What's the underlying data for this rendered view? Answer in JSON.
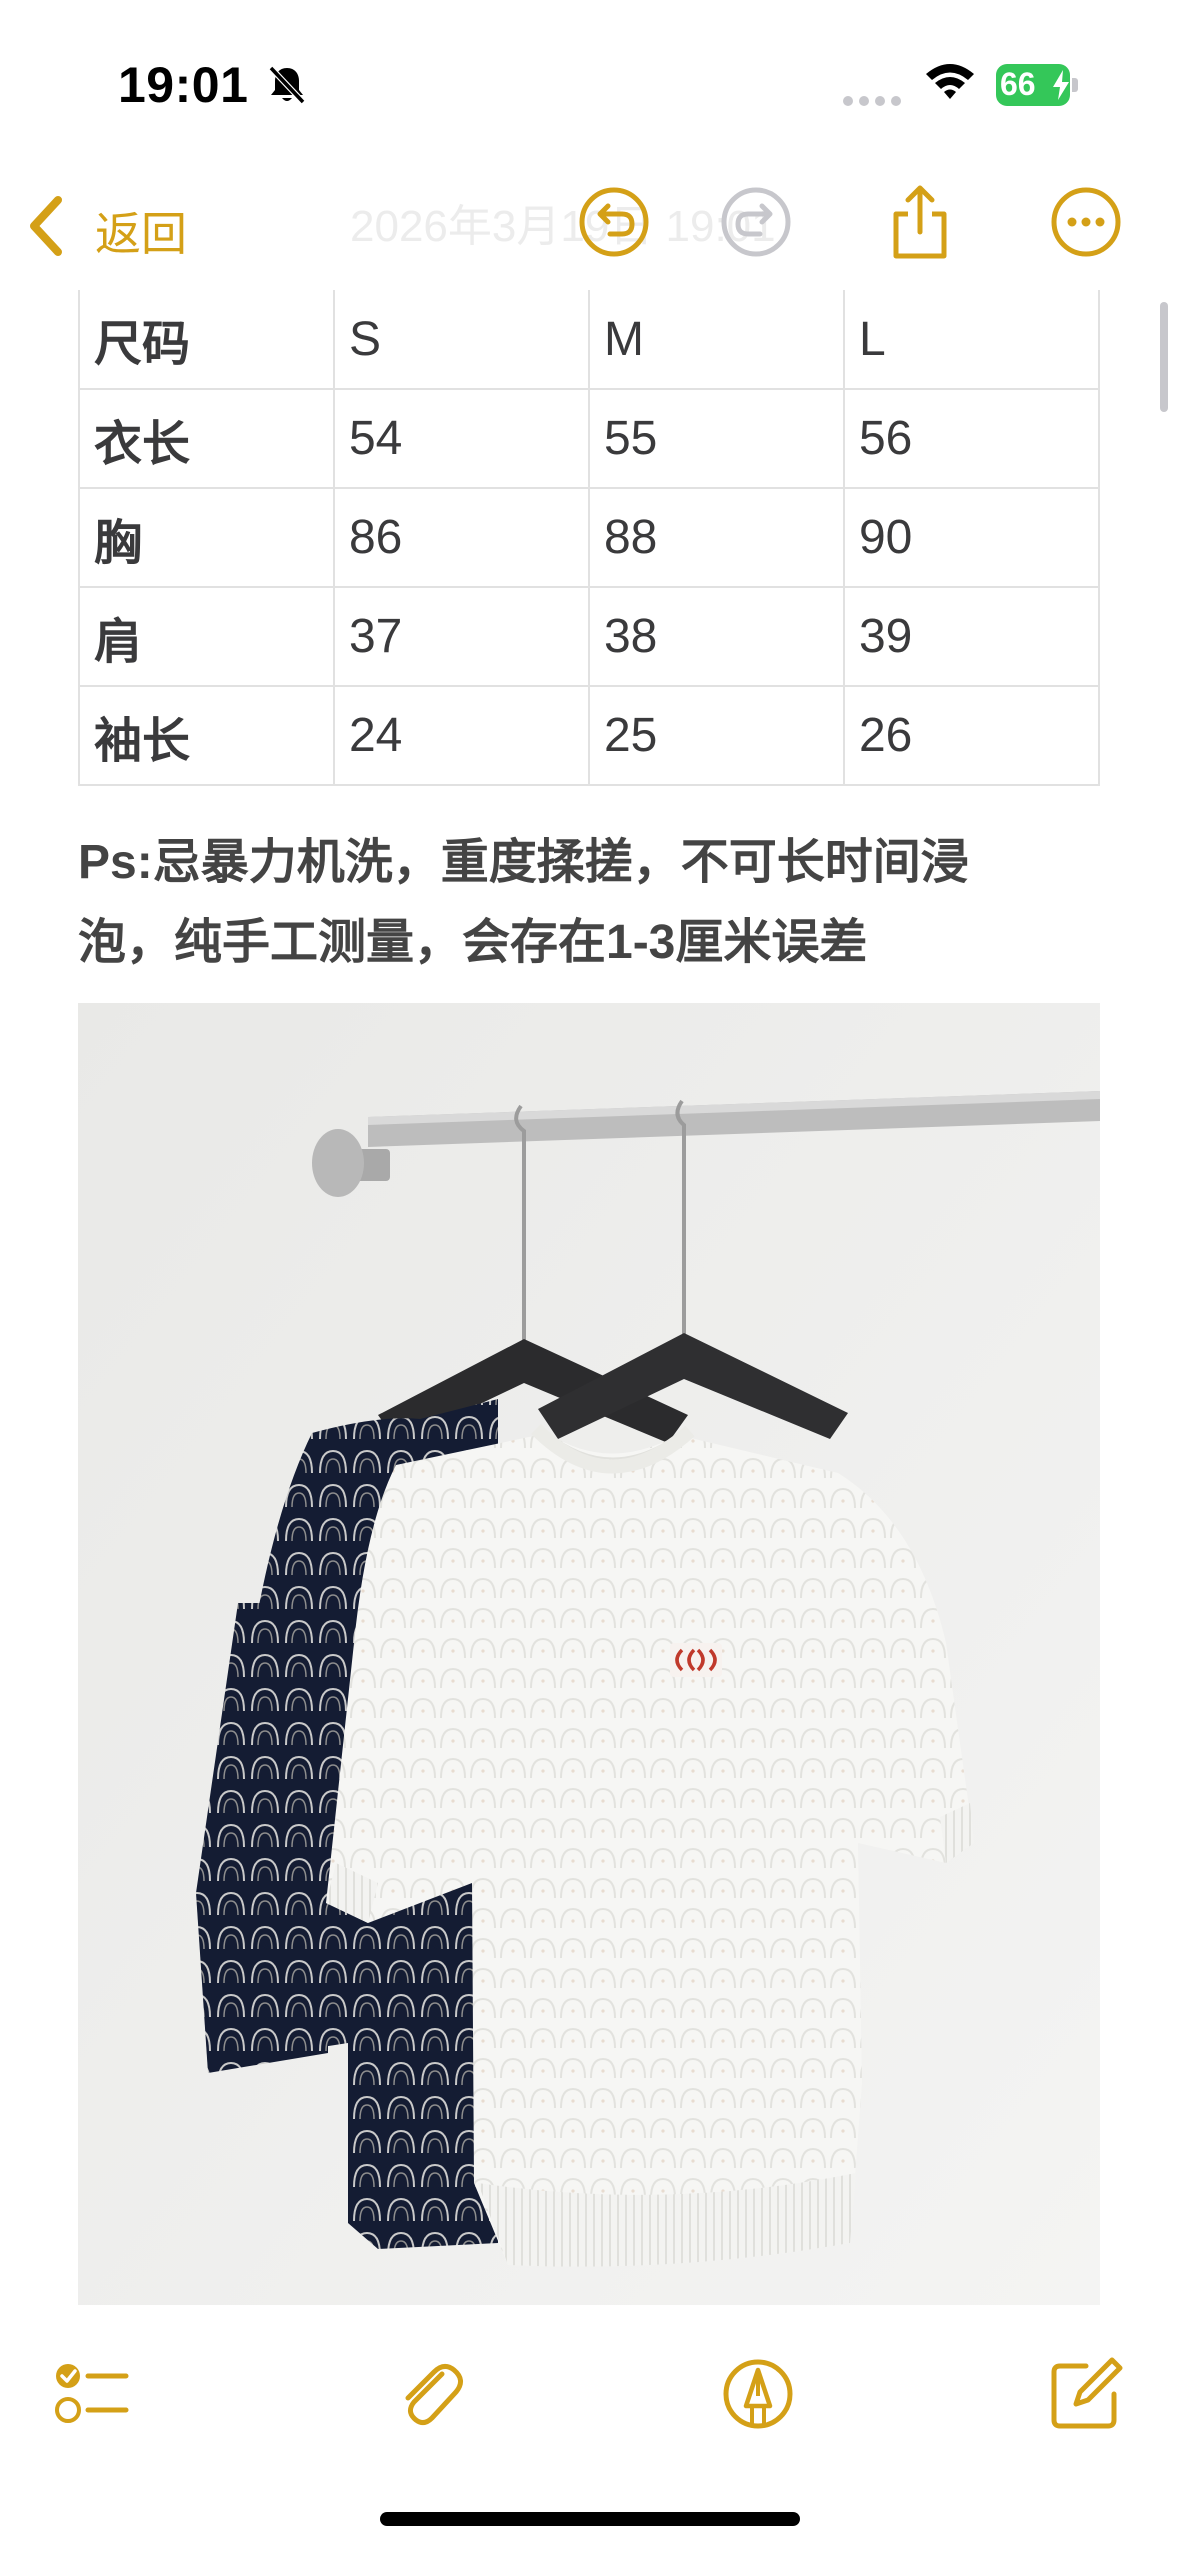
{
  "status_bar": {
    "time": "19:01",
    "battery": "66",
    "icons": [
      "bell-slash-icon",
      "cellular-signal-icon",
      "wifi-icon",
      "battery-charging-icon"
    ]
  },
  "nav": {
    "back_label": "返回",
    "faded_title": "2026年3月19日 19:01",
    "icons": [
      "undo-icon",
      "redo-icon",
      "share-icon",
      "more-icon"
    ]
  },
  "size_table": {
    "rows": [
      [
        "尺码",
        "S",
        "M",
        "L"
      ],
      [
        "衣长",
        "54",
        "55",
        "56"
      ],
      [
        "胸",
        "86",
        "88",
        "90"
      ],
      [
        "肩",
        "37",
        "38",
        "39"
      ],
      [
        "袖长",
        "24",
        "25",
        "26"
      ]
    ]
  },
  "note": {
    "line1": "Ps:忌暴力机洗，重度揉搓，不可长时间浸",
    "line2": "泡，纯手工测量，会存在1-3厘米误差"
  },
  "toolbar": {
    "icons": [
      "checklist-icon",
      "paperclip-icon",
      "markup-pen-icon",
      "compose-icon"
    ]
  },
  "colors": {
    "accent": "#d4a017",
    "disabled": "#c7c7cc",
    "battery_green": "#34c759",
    "table_border": "#e1e1e1"
  }
}
